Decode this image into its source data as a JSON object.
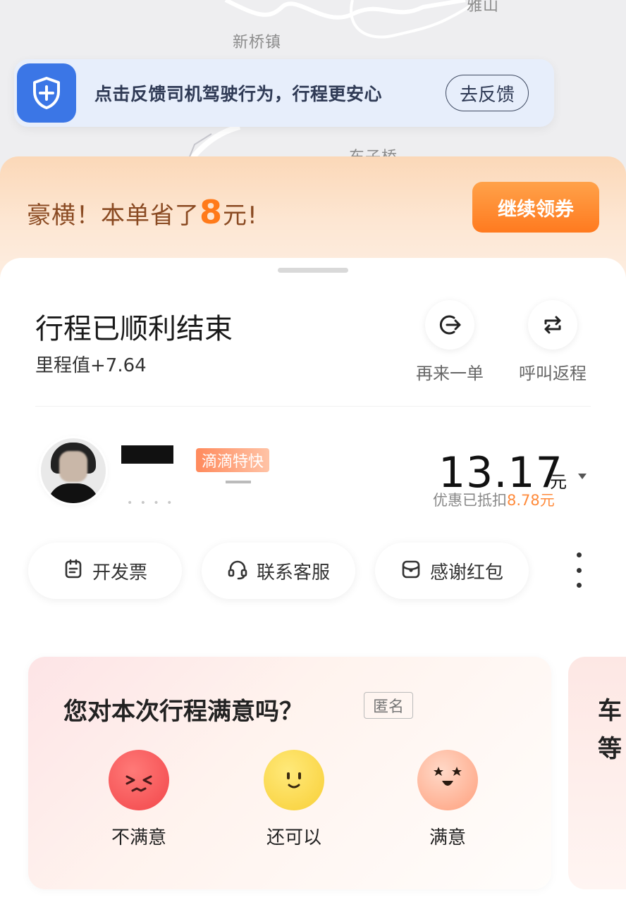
{
  "map": {
    "labels": [
      "新桥镇",
      "雅山",
      "东子桥"
    ]
  },
  "safety_banner": {
    "text": "点击反馈司机驾驶行为，行程更安心",
    "button": "去反馈",
    "icon": "shield-plus-icon",
    "accent": "#3b76e6"
  },
  "savings_banner": {
    "prefix": "豪横！本单省了",
    "amount": "8",
    "suffix": "元!",
    "button": "继续领券",
    "accent": "#ff7a1a"
  },
  "trip": {
    "title": "行程已顺利结束",
    "mileage": "里程值+7.64",
    "actions": [
      {
        "label": "再来一单",
        "icon": "reorder-arrow-icon"
      },
      {
        "label": "呼叫返程",
        "icon": "return-trip-icon"
      }
    ]
  },
  "driver": {
    "service_tag": "滴滴特快",
    "price": "13.17",
    "price_unit": "元",
    "discount_label": "优惠已抵扣",
    "discount_value": "8.78元"
  },
  "quick_actions": [
    {
      "label": "开发票",
      "icon": "invoice-icon"
    },
    {
      "label": "联系客服",
      "icon": "headset-icon"
    },
    {
      "label": "感谢红包",
      "icon": "red-envelope-icon"
    }
  ],
  "survey": {
    "title": "您对本次行程满意吗？",
    "badge": "匿名",
    "options": [
      {
        "label": "不满意",
        "icon": "angry-face-icon"
      },
      {
        "label": "还可以",
        "icon": "smile-face-icon"
      },
      {
        "label": "满意",
        "icon": "star-eyes-face-icon"
      }
    ],
    "peek_text": "车等"
  }
}
